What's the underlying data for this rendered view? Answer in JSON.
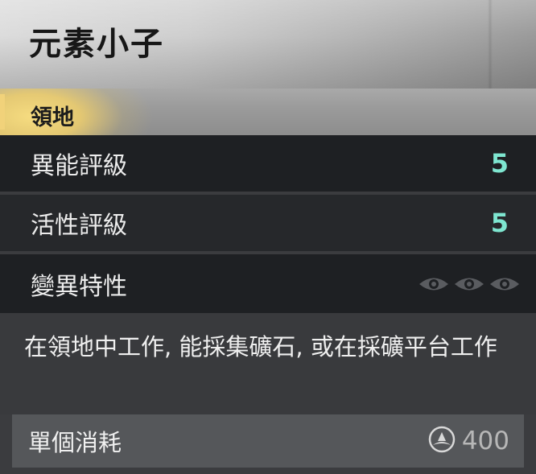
{
  "header": {
    "title": "元素小子"
  },
  "type": {
    "label": "領地",
    "accent": "#f1d27a"
  },
  "stats": [
    {
      "label": "異能評級",
      "value": "5"
    },
    {
      "label": "活性評級",
      "value": "5"
    },
    {
      "label": "變異特性",
      "icons": [
        "eye-icon",
        "eye-icon",
        "eye-icon"
      ]
    }
  ],
  "description": "在領地中工作, 能採集礦石, 或在採礦平台工作",
  "cost": {
    "label": "單個消耗",
    "value": "400",
    "icon": "resource-icon"
  },
  "colors": {
    "stat_value": "#7ee6d0"
  }
}
